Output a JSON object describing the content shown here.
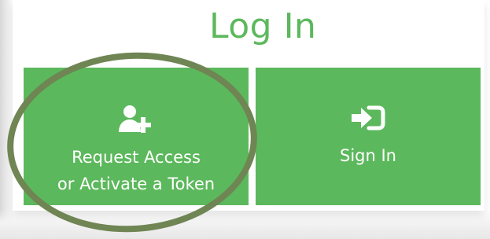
{
  "login": {
    "title": "Log In",
    "request_tile": {
      "icon": "add-user-icon",
      "line1": "Request Access",
      "line2": "or Activate a Token"
    },
    "signin_tile": {
      "icon": "sign-in-icon",
      "label": "Sign In"
    }
  },
  "colors": {
    "accent": "#5cb85c",
    "annotation": "#6f8553"
  }
}
